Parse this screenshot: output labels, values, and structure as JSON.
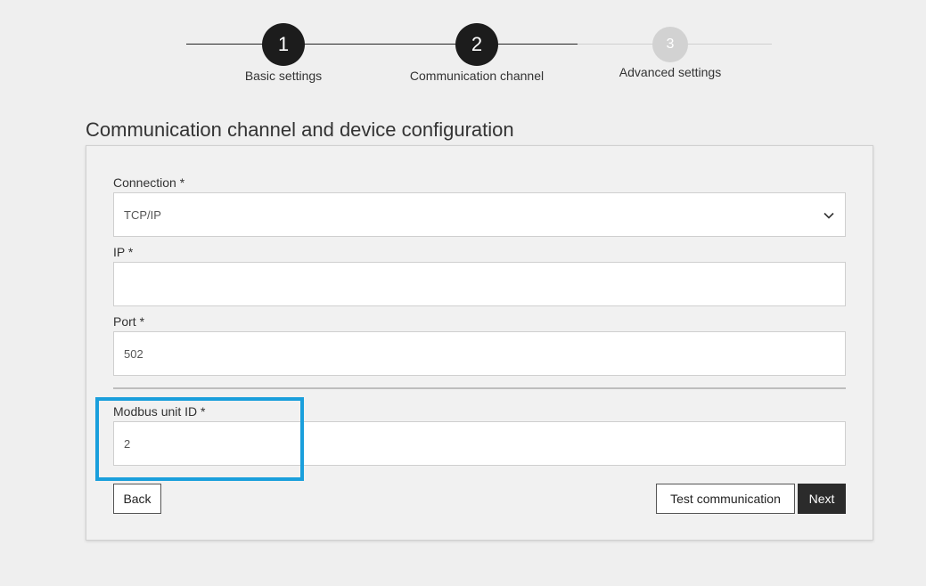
{
  "stepper": {
    "steps": [
      {
        "number": "1",
        "label": "Basic settings"
      },
      {
        "number": "2",
        "label": "Communication channel"
      },
      {
        "number": "3",
        "label": "Advanced settings"
      }
    ]
  },
  "page": {
    "title": "Communication channel and device configuration"
  },
  "form": {
    "connection": {
      "label": "Connection *",
      "value": "TCP/IP"
    },
    "ip": {
      "label": "IP *",
      "value": ""
    },
    "port": {
      "label": "Port *",
      "value": "502"
    },
    "unit_id": {
      "label": "Modbus unit ID *",
      "value": "2"
    }
  },
  "actions": {
    "back": "Back",
    "test": "Test communication",
    "next": "Next"
  },
  "colors": {
    "active_step": "#1c1c1c",
    "inactive_step": "#d2d2d2",
    "highlight": "#1a9fdc",
    "primary_button": "#2b2b2b"
  }
}
